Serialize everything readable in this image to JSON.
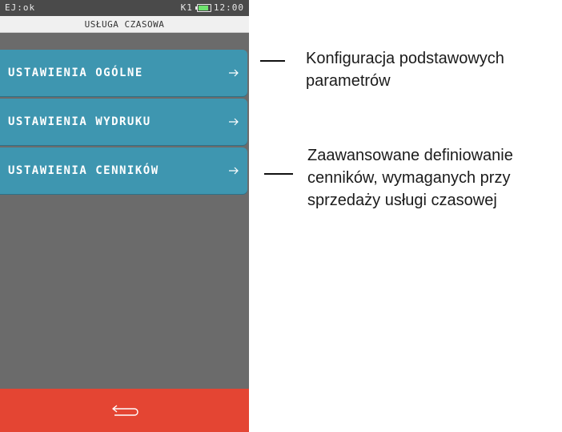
{
  "status_bar": {
    "left_text": "EJ:ok",
    "station": "K1",
    "time": "12:00",
    "battery_level": 0.9,
    "battery_color": "#6fe36f"
  },
  "header": {
    "title": "USŁUGA CZASOWA"
  },
  "menu": {
    "items": [
      {
        "label": "USTAWIENIA OGÓLNE"
      },
      {
        "label": "USTAWIENIA WYDRUKU"
      },
      {
        "label": "USTAWIENIA CENNIKÓW"
      }
    ],
    "arrow_icon": "arrow-right-icon",
    "item_color": "#3e96b0"
  },
  "back_bar": {
    "icon": "back-arrow-icon",
    "color": "#e44533"
  },
  "callouts": [
    {
      "text": "Konfiguracja podstawowych parametrów"
    },
    {
      "text": "Zaawansowane definiowanie cenników, wymaganych przy sprzedaży usługi czasowej"
    }
  ]
}
